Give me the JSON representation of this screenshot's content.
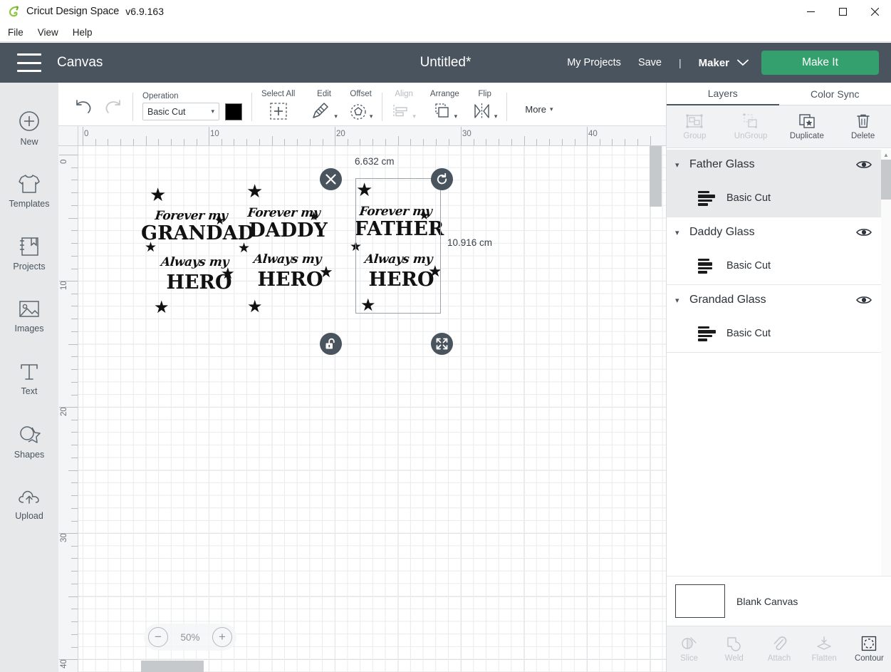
{
  "window": {
    "app_name": "Cricut Design Space",
    "version": "v6.9.163",
    "minimize": "—",
    "maximize": "□",
    "close": "✕"
  },
  "menubar": {
    "items": [
      "File",
      "View",
      "Help"
    ]
  },
  "header": {
    "hamburger": "menu-icon",
    "canvas_label": "Canvas",
    "doc_title": "Untitled*",
    "my_projects": "My Projects",
    "save": "Save",
    "separator": "|",
    "machine": "Maker",
    "make_it": "Make It",
    "accent_green": "#33a06e",
    "header_bg": "#4a545e"
  },
  "rail": {
    "items": [
      {
        "label": "New",
        "icon": "plus-circle-icon"
      },
      {
        "label": "Templates",
        "icon": "tshirt-icon"
      },
      {
        "label": "Projects",
        "icon": "book-icon"
      },
      {
        "label": "Images",
        "icon": "picture-icon"
      },
      {
        "label": "Text",
        "icon": "text-t-icon"
      },
      {
        "label": "Shapes",
        "icon": "shapes-icon"
      },
      {
        "label": "Upload",
        "icon": "cloud-upload-icon"
      }
    ]
  },
  "toolbar": {
    "undo": "undo-icon",
    "redo": "redo-icon",
    "operation_label": "Operation",
    "operation_value": "Basic Cut",
    "operation_color": "#000000",
    "select_all": "Select All",
    "edit": "Edit",
    "offset": "Offset",
    "align": "Align",
    "arrange": "Arrange",
    "flip": "Flip",
    "more": "More",
    "caret": "▾",
    "disabled": [
      "Align"
    ]
  },
  "canvas": {
    "ruler_h": [
      "0",
      "10",
      "20",
      "30",
      "40"
    ],
    "ruler_v": [
      "0",
      "10",
      "20",
      "30",
      "40"
    ],
    "zoom_level": "50%",
    "zoom_out": "−",
    "zoom_in": "+",
    "selection": {
      "width_label": "6.632 cm",
      "height_label": "10.916 cm",
      "delete_handle": "close-icon",
      "rotate_handle": "rotate-icon",
      "lock_handle": "unlock-icon",
      "resize_handle": "resize-icon"
    },
    "designs": [
      {
        "name": "Grandad Glass",
        "line1": "Forever my",
        "line2": "GRANDAD",
        "line3": "Always my",
        "line4": "HERO"
      },
      {
        "name": "Daddy Glass",
        "line1": "Forever my",
        "line2": "DADDY",
        "line3": "Always my",
        "line4": "HERO"
      },
      {
        "name": "Father Glass",
        "line1": "Forever my",
        "line2": "FATHER",
        "line3": "Always my",
        "line4": "HERO"
      }
    ]
  },
  "right_panel": {
    "tabs": [
      {
        "label": "Layers",
        "active": true
      },
      {
        "label": "Color Sync",
        "active": false
      }
    ],
    "tools": [
      {
        "label": "Group",
        "icon": "group-icon",
        "disabled": true
      },
      {
        "label": "UnGroup",
        "icon": "ungroup-icon",
        "disabled": true
      },
      {
        "label": "Duplicate",
        "icon": "duplicate-icon",
        "disabled": false
      },
      {
        "label": "Delete",
        "icon": "trash-icon",
        "disabled": false
      }
    ],
    "layers": [
      {
        "name": "Father Glass",
        "sublayer": "Basic Cut",
        "selected": true,
        "eye": "eye-icon",
        "caret": "▾"
      },
      {
        "name": "Daddy Glass",
        "sublayer": "Basic Cut",
        "selected": false,
        "eye": "eye-icon",
        "caret": "▾"
      },
      {
        "name": "Grandad Glass",
        "sublayer": "Basic Cut",
        "selected": false,
        "eye": "eye-icon",
        "caret": "▾"
      }
    ],
    "canvas_swatch_label": "Blank Canvas",
    "bottom_tools": [
      {
        "label": "Slice",
        "icon": "slice-icon",
        "disabled": true
      },
      {
        "label": "Weld",
        "icon": "weld-icon",
        "disabled": true
      },
      {
        "label": "Attach",
        "icon": "paperclip-icon",
        "disabled": true
      },
      {
        "label": "Flatten",
        "icon": "flatten-icon",
        "disabled": true
      },
      {
        "label": "Contour",
        "icon": "contour-icon",
        "disabled": false
      }
    ]
  }
}
